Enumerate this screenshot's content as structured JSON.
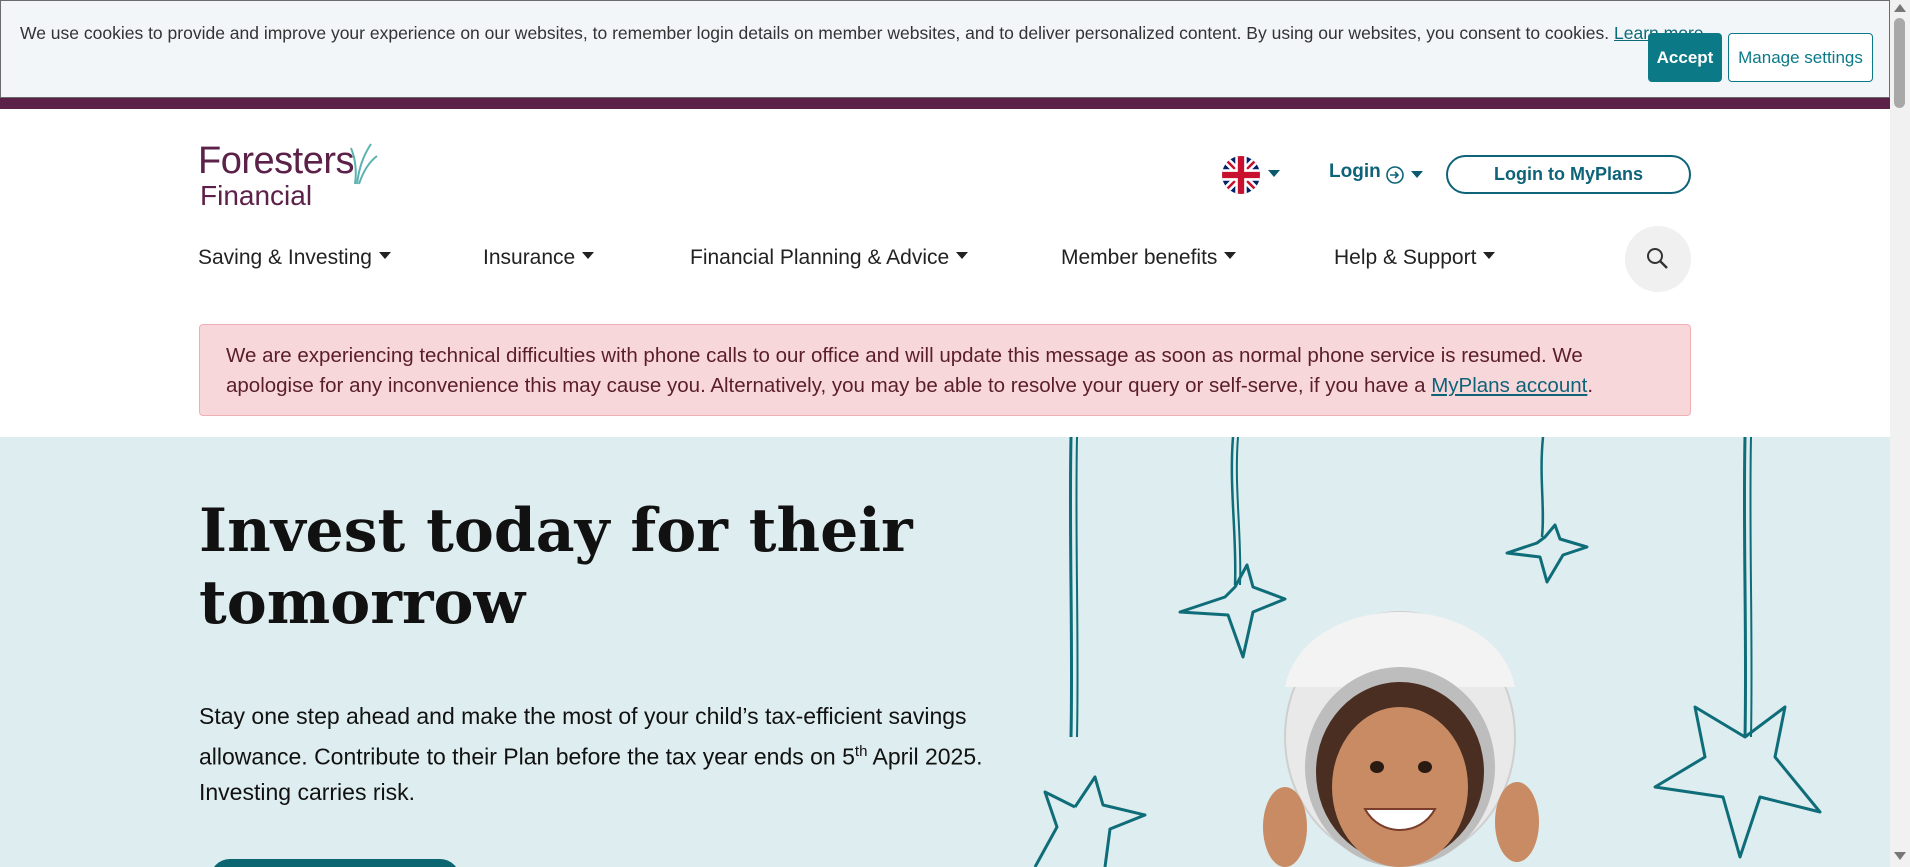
{
  "cookie_banner": {
    "text": "We use cookies to provide and improve your experience on our websites, to remember login details on member websites, and to deliver personalized content. By using our websites, you consent to cookies.",
    "learn_more": "Learn more",
    "period": ".",
    "accept_label": "Accept",
    "manage_label": "Manage settings"
  },
  "header": {
    "logo_line1": "Foresters",
    "logo_line2": "Financial",
    "language_icon": "uk-flag-icon",
    "login_label": "Login",
    "myplans_label": "Login to MyPlans"
  },
  "nav": {
    "items": [
      {
        "label": "Saving & Investing"
      },
      {
        "label": "Insurance"
      },
      {
        "label": "Financial Planning & Advice"
      },
      {
        "label": "Member benefits"
      },
      {
        "label": "Help & Support"
      }
    ],
    "search_icon": "search-icon"
  },
  "alert": {
    "text": "We are experiencing technical difficulties with phone calls to our office and will update this message as soon as normal phone service is resumed. We apologise for any inconvenience this may cause you. Alternatively, you may be able to resolve your query or self-serve, if you have a",
    "link": "MyPlans account",
    "period": "."
  },
  "hero": {
    "title": "Invest today for their tomorrow",
    "desc_part1": "Stay one step ahead and make the most of your child’s tax-efficient savings allowance. Contribute to their Plan before the tax year ends on 5",
    "desc_sup": "th",
    "desc_part2": " April 2025. Investing carries risk."
  },
  "colors": {
    "brand_purple": "#5b2148",
    "brand_teal": "#0b7a86",
    "alert_bg": "#f8d7da",
    "hero_bg": "#deedef"
  }
}
